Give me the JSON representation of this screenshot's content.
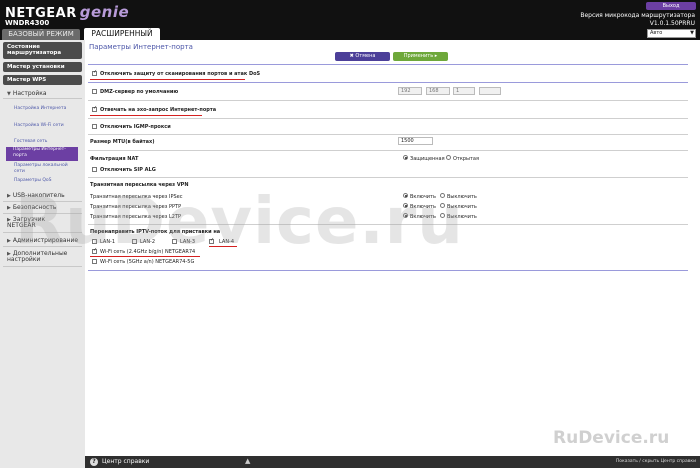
{
  "header": {
    "brand": "NETGEAR",
    "product": "genie",
    "model": "WNDR4300",
    "logout": "Выход",
    "fw_label": "Версия микрокода маршрутизатора",
    "fw_version": "V1.0.1.50PRRU",
    "language": "Авто"
  },
  "tabs": {
    "basic": "БАЗОВЫЙ РЕЖИМ",
    "advanced": "РАСШИРЕННЫЙ"
  },
  "sidebar": {
    "status": "Состояние маршрутизатора",
    "setup_wizard": "Мастер установки",
    "wps_wizard": "Мастер WPS",
    "setup_section": "Настройка",
    "sub_items": [
      "Настройка Интернета",
      "Настройка Wi-Fi сети",
      "Гостевая сеть",
      "Параметры Интернет-порта",
      "Параметры локальной сети",
      "Параметры QoS"
    ],
    "usb": "USB-накопитель",
    "security": "Безопасность",
    "download": "Загрузчик NETGEAR",
    "admin": "Администрирование",
    "advanced": "Дополнительные настройки"
  },
  "main": {
    "title": "Параметры Интернет-порта",
    "cancel": "Отмена",
    "apply": "Применить",
    "dos": "Отключить защиту от сканирования портов и атак DoS",
    "dmz": "DMZ-сервер по умолчанию",
    "dmz_ip": [
      "192",
      "168",
      "1",
      ""
    ],
    "ping": "Отвечать на эхо-запрос Интернет-порта",
    "igmp": "Отключить IGMP-прокси",
    "mtu_label": "Размер MTU(в байтах)",
    "mtu_value": "1500",
    "nat_label": "Фильтрация NAT",
    "nat_secure": "Защищенная",
    "nat_open": "Открытая",
    "sip": "Отключить SIP ALG",
    "vpn_title": "Транзитная пересылка через VPN",
    "vpn_ipsec": "Транзитная пересылка через IPSec",
    "vpn_pptp": "Транзитная пересылка через PPTP",
    "vpn_l2tp": "Транзитная пересылка через L2TP",
    "enable": "Включить",
    "disable": "Выключить",
    "iptv_title": "Перенаправить IPTV-поток для приставки на",
    "lan": [
      "LAN-1",
      "LAN-2",
      "LAN-3",
      "LAN-4"
    ],
    "wifi24": "Wi-Fi сеть (2.4GHz b/g/n) NETGEAR74",
    "wifi5": "Wi-Fi сеть (5GHz a/n) NETGEAR74-5G"
  },
  "footer": {
    "help": "Центр справки",
    "links": "Показать / скрыть Центр справки"
  },
  "watermark": "RuDevice.ru",
  "corner_watermark": "RuDevice.ru"
}
